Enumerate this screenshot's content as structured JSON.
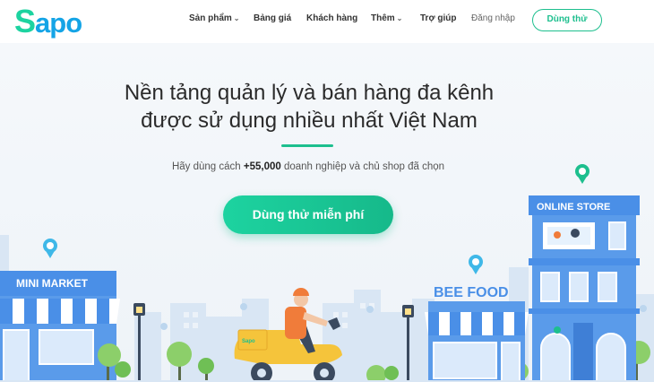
{
  "brand": {
    "logo_first": "S",
    "logo_rest": "apo"
  },
  "nav": {
    "items": [
      {
        "label": "Sản phẩm",
        "dropdown": true
      },
      {
        "label": "Bảng giá",
        "dropdown": false
      },
      {
        "label": "Khách hàng",
        "dropdown": false
      },
      {
        "label": "Thêm",
        "dropdown": true
      },
      {
        "label": "Trợ giúp",
        "dropdown": false
      }
    ],
    "login": "Đăng nhập",
    "try_button": "Dùng thử"
  },
  "hero": {
    "title_line1": "Nền tảng quản lý và bán hàng đa kênh",
    "title_line2": "được sử dụng nhiều nhất Việt Nam",
    "subtitle_prefix": "Hãy dùng cách ",
    "subtitle_count": "+55,000",
    "subtitle_suffix": " doanh nghiệp và chủ shop đã chọn",
    "cta": "Dùng thử miễn phí"
  },
  "illustration": {
    "mini_market": "MINI MARKET",
    "bee_food": "BEE FOOD",
    "online_store": "ONLINE STORE",
    "scooter_box": "Sapo"
  },
  "colors": {
    "brand_blue": "#14a4e6",
    "brand_green": "#1dbf8e",
    "store_blue": "#4a8fe7"
  }
}
